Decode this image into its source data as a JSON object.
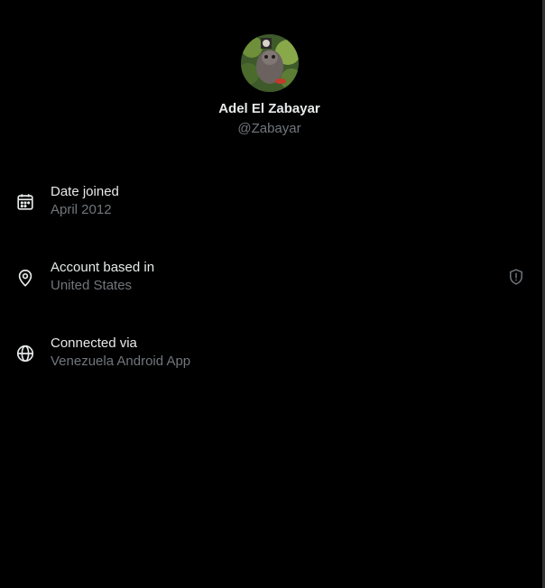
{
  "profile": {
    "display_name": "Adel El Zabayar",
    "handle": "@Zabayar"
  },
  "info": {
    "date_joined": {
      "label": "Date joined",
      "value": "April 2012",
      "icon": "calendar-icon"
    },
    "account_based_in": {
      "label": "Account based in",
      "value": "United States",
      "icon": "location-pin-icon",
      "badge_icon": "shield-alert-icon"
    },
    "connected_via": {
      "label": "Connected via",
      "value": "Venezuela Android App",
      "icon": "globe-icon"
    }
  },
  "colors": {
    "background": "#000000",
    "primary_text": "#e7e9ea",
    "secondary_text": "#71767b"
  }
}
